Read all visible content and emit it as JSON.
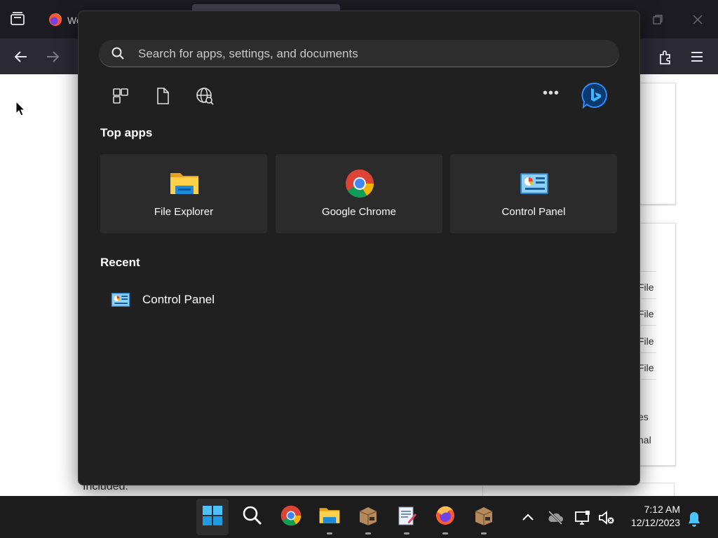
{
  "firefox": {
    "tab_title": "We",
    "ff_back_icon": "arrow-left-icon",
    "ff_forward_icon": "arrow-right-icon"
  },
  "page_behind": {
    "sidebar_fragments": [
      "File",
      "File",
      "File",
      "File",
      "es",
      "nal"
    ],
    "included_text": "Included."
  },
  "start_menu": {
    "search_placeholder": "Search for apps, settings, and documents",
    "filters": [
      {
        "name": "apps",
        "icon": "apps-grid-icon"
      },
      {
        "name": "documents",
        "icon": "document-icon"
      },
      {
        "name": "web",
        "icon": "globe-search-icon"
      }
    ],
    "more_label": "•••",
    "top_apps_title": "Top apps",
    "top_apps": [
      {
        "label": "File Explorer",
        "icon": "folder-icon"
      },
      {
        "label": "Google Chrome",
        "icon": "chrome-icon"
      },
      {
        "label": "Control Panel",
        "icon": "control-panel-icon"
      }
    ],
    "recent_title": "Recent",
    "recent": [
      {
        "label": "Control Panel",
        "icon": "control-panel-icon"
      }
    ]
  },
  "taskbar": {
    "items": [
      {
        "name": "start",
        "icon": "windows-start-icon",
        "active": true
      },
      {
        "name": "search",
        "icon": "search-icon"
      },
      {
        "name": "chrome",
        "icon": "chrome-icon"
      },
      {
        "name": "file-explorer",
        "icon": "folder-icon"
      },
      {
        "name": "package-1",
        "icon": "package-icon"
      },
      {
        "name": "notepad",
        "icon": "text-editor-icon"
      },
      {
        "name": "firefox",
        "icon": "firefox-icon"
      },
      {
        "name": "package-2",
        "icon": "package-icon"
      }
    ],
    "time": "7:12 AM",
    "date": "12/12/2023"
  },
  "colors": {
    "start_bg": "#202020",
    "tile_bg": "#2b2b2b",
    "taskbar_bg": "#1c1c1c",
    "accent": "#0078d4"
  }
}
